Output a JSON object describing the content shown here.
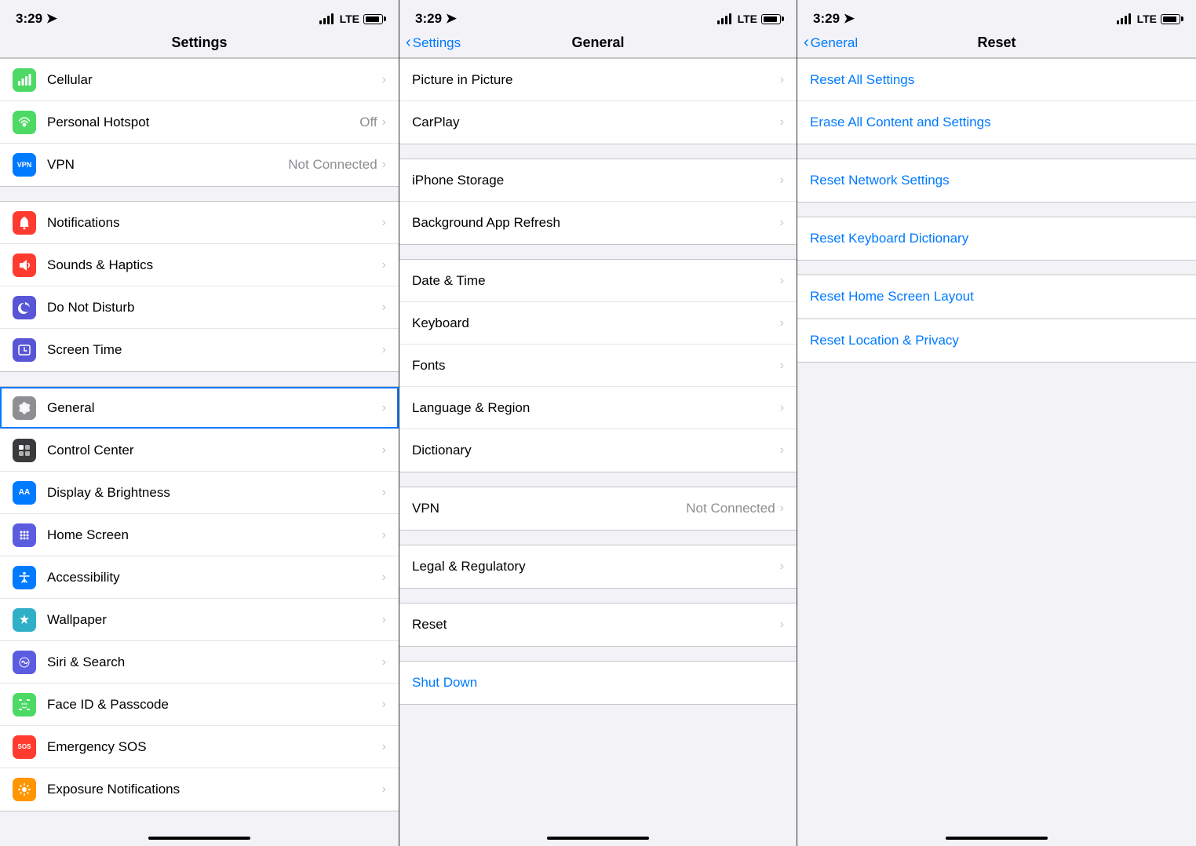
{
  "panels": [
    {
      "id": "settings",
      "statusBar": {
        "time": "3:29",
        "lte": "LTE"
      },
      "navTitle": "Settings",
      "navBack": null,
      "sections": [
        {
          "items": [
            {
              "icon": "cellular",
              "iconColor": "ic-green",
              "iconGlyph": "📶",
              "label": "Cellular",
              "value": "",
              "chevron": true
            },
            {
              "icon": "hotspot",
              "iconColor": "ic-green",
              "iconGlyph": "🔗",
              "label": "Personal Hotspot",
              "value": "Off",
              "chevron": true
            },
            {
              "icon": "vpn",
              "iconColor": "ic-vpn",
              "iconGlyph": "VPN",
              "label": "VPN",
              "value": "Not Connected",
              "chevron": true
            }
          ]
        },
        {
          "items": [
            {
              "icon": "notifications",
              "iconColor": "ic-red",
              "iconGlyph": "🔔",
              "label": "Notifications",
              "value": "",
              "chevron": true
            },
            {
              "icon": "sounds",
              "iconColor": "ic-red",
              "iconGlyph": "🔊",
              "label": "Sounds & Haptics",
              "value": "",
              "chevron": true
            },
            {
              "icon": "donotdisturb",
              "iconColor": "ic-purple",
              "iconGlyph": "🌙",
              "label": "Do Not Disturb",
              "value": "",
              "chevron": true
            },
            {
              "icon": "screentime",
              "iconColor": "ic-purple",
              "iconGlyph": "⏱",
              "label": "Screen Time",
              "value": "",
              "chevron": true
            }
          ]
        },
        {
          "items": [
            {
              "icon": "general",
              "iconColor": "ic-gearGray",
              "iconGlyph": "⚙️",
              "label": "General",
              "value": "",
              "chevron": true,
              "selected": true
            },
            {
              "icon": "controlcenter",
              "iconColor": "ic-dark",
              "iconGlyph": "⊞",
              "label": "Control Center",
              "value": "",
              "chevron": true
            },
            {
              "icon": "display",
              "iconColor": "ic-blue",
              "iconGlyph": "AA",
              "label": "Display & Brightness",
              "value": "",
              "chevron": true
            },
            {
              "icon": "homescreen",
              "iconColor": "ic-indigo",
              "iconGlyph": "⠿",
              "label": "Home Screen",
              "value": "",
              "chevron": true
            },
            {
              "icon": "accessibility",
              "iconColor": "ic-blue",
              "iconGlyph": "♿",
              "label": "Accessibility",
              "value": "",
              "chevron": true
            },
            {
              "icon": "wallpaper",
              "iconColor": "ic-teal2",
              "iconGlyph": "✿",
              "label": "Wallpaper",
              "value": "",
              "chevron": true
            },
            {
              "icon": "siri",
              "iconColor": "ic-indigo",
              "iconGlyph": "🎤",
              "label": "Siri & Search",
              "value": "",
              "chevron": true
            },
            {
              "icon": "faceid",
              "iconColor": "ic-green",
              "iconGlyph": "👤",
              "label": "Face ID & Passcode",
              "value": "",
              "chevron": true
            },
            {
              "icon": "sos",
              "iconColor": "ic-red",
              "iconGlyph": "SOS",
              "label": "Emergency SOS",
              "value": "",
              "chevron": true
            },
            {
              "icon": "exposure",
              "iconColor": "ic-orange",
              "iconGlyph": "☀",
              "label": "Exposure Notifications",
              "value": "",
              "chevron": true
            }
          ]
        }
      ]
    },
    {
      "id": "general",
      "statusBar": {
        "time": "3:29",
        "lte": "LTE"
      },
      "navTitle": "General",
      "navBack": "Settings",
      "sections": [
        {
          "items": [
            {
              "label": "Picture in Picture",
              "value": "",
              "chevron": true
            },
            {
              "label": "CarPlay",
              "value": "",
              "chevron": true
            }
          ]
        },
        {
          "items": [
            {
              "label": "iPhone Storage",
              "value": "",
              "chevron": true
            },
            {
              "label": "Background App Refresh",
              "value": "",
              "chevron": true
            }
          ]
        },
        {
          "items": [
            {
              "label": "Date & Time",
              "value": "",
              "chevron": true
            },
            {
              "label": "Keyboard",
              "value": "",
              "chevron": true
            },
            {
              "label": "Fonts",
              "value": "",
              "chevron": true
            },
            {
              "label": "Language & Region",
              "value": "",
              "chevron": true
            },
            {
              "label": "Dictionary",
              "value": "",
              "chevron": true
            }
          ]
        },
        {
          "items": [
            {
              "label": "VPN",
              "value": "Not Connected",
              "chevron": true
            }
          ]
        },
        {
          "items": [
            {
              "label": "Legal & Regulatory",
              "value": "",
              "chevron": true
            }
          ]
        },
        {
          "items": [
            {
              "label": "Reset",
              "value": "",
              "chevron": true,
              "highlighted": true
            }
          ]
        },
        {
          "shutdown": true,
          "label": "Shut Down",
          "isBlue": true
        }
      ]
    },
    {
      "id": "reset",
      "statusBar": {
        "time": "3:29",
        "lte": "LTE"
      },
      "navTitle": "Reset",
      "navBack": "General",
      "sections": [
        {
          "items": [
            {
              "label": "Reset All Settings",
              "isBlue": true
            },
            {
              "label": "Erase All Content and Settings",
              "isBlue": true
            }
          ]
        },
        {
          "items": [
            {
              "label": "Reset Network Settings",
              "isBlue": true
            }
          ]
        },
        {
          "items": [
            {
              "label": "Reset Keyboard Dictionary",
              "isBlue": true
            }
          ]
        },
        {
          "items": [
            {
              "label": "Reset Home Screen Layout",
              "isBlue": true,
              "highlighted": true
            }
          ]
        },
        {
          "items": [
            {
              "label": "Reset Location & Privacy",
              "isBlue": true
            }
          ]
        }
      ]
    }
  ]
}
